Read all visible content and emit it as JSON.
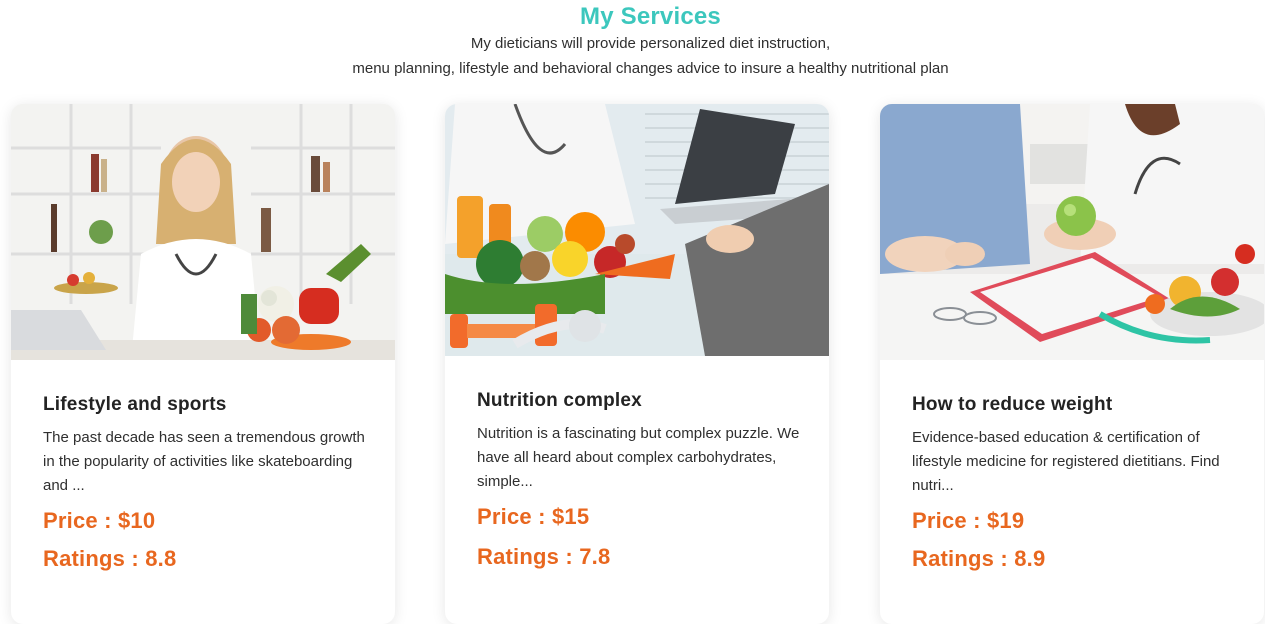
{
  "header": {
    "title": "My Services",
    "subtitle_line1": "My dieticians will provide personalized diet instruction,",
    "subtitle_line2": "menu planning, lifestyle and behavioral changes advice to insure a healthy nutritional plan"
  },
  "services": [
    {
      "title": "Lifestyle and sports",
      "description": "The past decade has seen a tremendous growth in the popularity of activities like skateboarding and ...",
      "price_label": "Price : $10",
      "ratings_label": "Ratings : 8.8"
    },
    {
      "title": "Nutrition complex",
      "description": "Nutrition is a fascinating but complex puzzle. We have all heard about complex carbohydrates, simple...",
      "price_label": "Price : $15",
      "ratings_label": "Ratings : 7.8"
    },
    {
      "title": "How to reduce weight",
      "description": "Evidence-based education & certification of lifestyle medicine for registered dietitians. Find nutri...",
      "price_label": "Price : $19",
      "ratings_label": "Ratings : 8.9"
    }
  ],
  "colors": {
    "title": "#3cc7bd",
    "price": "#e8671f",
    "text": "#2f2f2f"
  }
}
